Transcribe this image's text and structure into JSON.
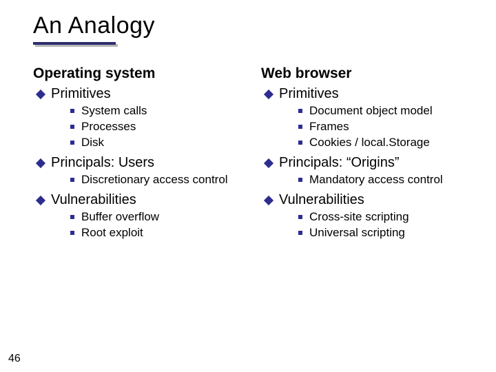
{
  "title": "An Analogy",
  "page_number": "46",
  "columns": [
    {
      "heading": "Operating system",
      "sections": [
        {
          "label": "Primitives",
          "items": [
            "System calls",
            "Processes",
            "Disk"
          ]
        },
        {
          "label": "Principals: Users",
          "items": [
            "Discretionary access control"
          ]
        },
        {
          "label": "Vulnerabilities",
          "items": [
            "Buffer overflow",
            "Root exploit"
          ]
        }
      ]
    },
    {
      "heading": "Web browser",
      "sections": [
        {
          "label": "Primitives",
          "items": [
            "Document object model",
            "Frames",
            "Cookies / local.Storage"
          ]
        },
        {
          "label": "Principals: “Origins”",
          "items": [
            "Mandatory access control"
          ]
        },
        {
          "label": "Vulnerabilities",
          "items": [
            "Cross-site scripting",
            "Universal scripting"
          ]
        }
      ]
    }
  ]
}
